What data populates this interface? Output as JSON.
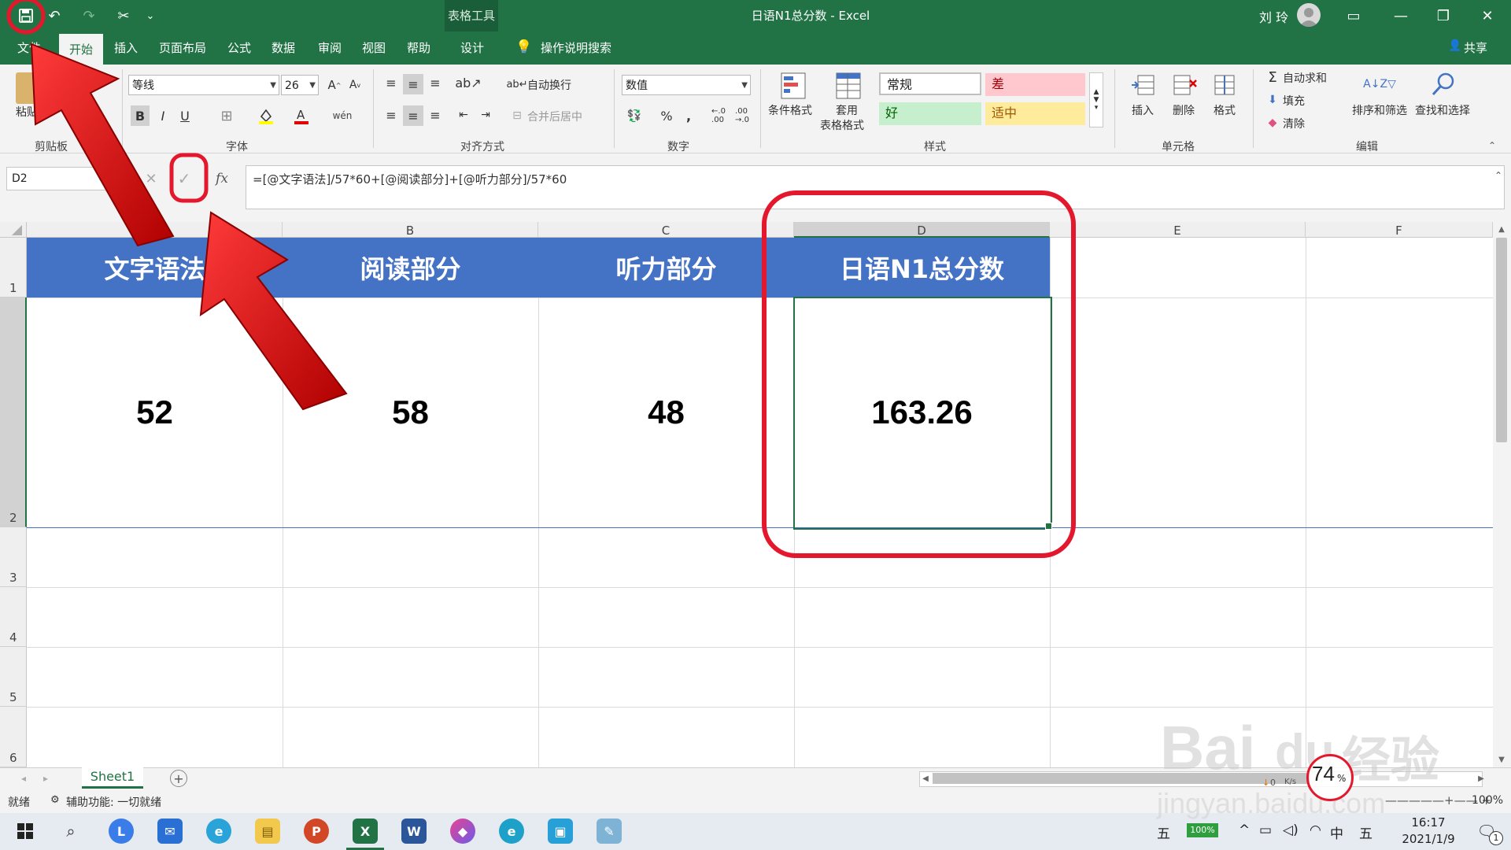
{
  "title_bar": {
    "title": "日语N1总分数 - Excel",
    "context_tab_group": "表格工具",
    "user_name": "刘 玲"
  },
  "menu": {
    "items": [
      "文件",
      "开始",
      "插入",
      "页面布局",
      "公式",
      "数据",
      "审阅",
      "视图",
      "帮助",
      "设计"
    ],
    "tell_me": "操作说明搜索",
    "share": "共享"
  },
  "ribbon": {
    "clipboard": {
      "cut": "剪切",
      "paste": "粘贴",
      "group": "剪贴板"
    },
    "font": {
      "name": "等线",
      "size": "26",
      "group": "字体"
    },
    "alignment": {
      "wrap": "自动换行",
      "merge": "合并后居中",
      "group": "对齐方式"
    },
    "number": {
      "format": "数值",
      "percent": "%",
      "comma": ",",
      "group": "数字"
    },
    "styles": {
      "conditional": "条件格式",
      "table_format_1": "套用",
      "table_format_2": "表格格式",
      "normal": "常规",
      "bad": "差",
      "good": "好",
      "neutral": "适中",
      "group": "样式"
    },
    "cells": {
      "insert": "插入",
      "delete": "删除",
      "format": "格式",
      "group": "单元格"
    },
    "editing": {
      "autosum": "自动求和",
      "fill": "填充",
      "clear": "清除",
      "sort": "排序和筛选",
      "find": "查找和选择",
      "group": "编辑"
    }
  },
  "formula_bar": {
    "name_box": "D2",
    "formula": "=[@文字语法]/57*60+[@阅读部分]+[@听力部分]/57*60",
    "fx": "fx"
  },
  "sheet": {
    "columns": [
      "A",
      "B",
      "C",
      "D",
      "E",
      "F"
    ],
    "rows": [
      "1",
      "2",
      "3",
      "4",
      "5",
      "6"
    ],
    "headers": [
      "文字语法",
      "阅读部分",
      "听力部分",
      "日语N1总分数"
    ],
    "values": [
      "52",
      "58",
      "48",
      "163.26"
    ],
    "tab": "Sheet1"
  },
  "status_bar": {
    "ready": "就绪",
    "accessibility": "辅助功能: 一切就绪",
    "zoom": "100%"
  },
  "taskbar": {
    "ime": "五",
    "battery": "100%",
    "lang": "中",
    "ime2": "五",
    "time": "16:17",
    "date": "2021/1/9",
    "notifications": "1"
  },
  "overlay": {
    "speed_gauge": "74",
    "speed_unit": "%",
    "net_speed": "0",
    "net_unit": "K/s",
    "watermark_main": "Bai",
    "watermark_mid": "du",
    "watermark_cn": "经验",
    "watermark_url": "jingyan.baidu.com"
  },
  "colors": {
    "excel_green": "#217346",
    "table_header_blue": "#4472c4",
    "highlight_red": "#e3182d",
    "style_bad_bg": "#ffc7ce",
    "style_good_bg": "#c6efce",
    "style_neutral_bg": "#ffeb9c"
  }
}
